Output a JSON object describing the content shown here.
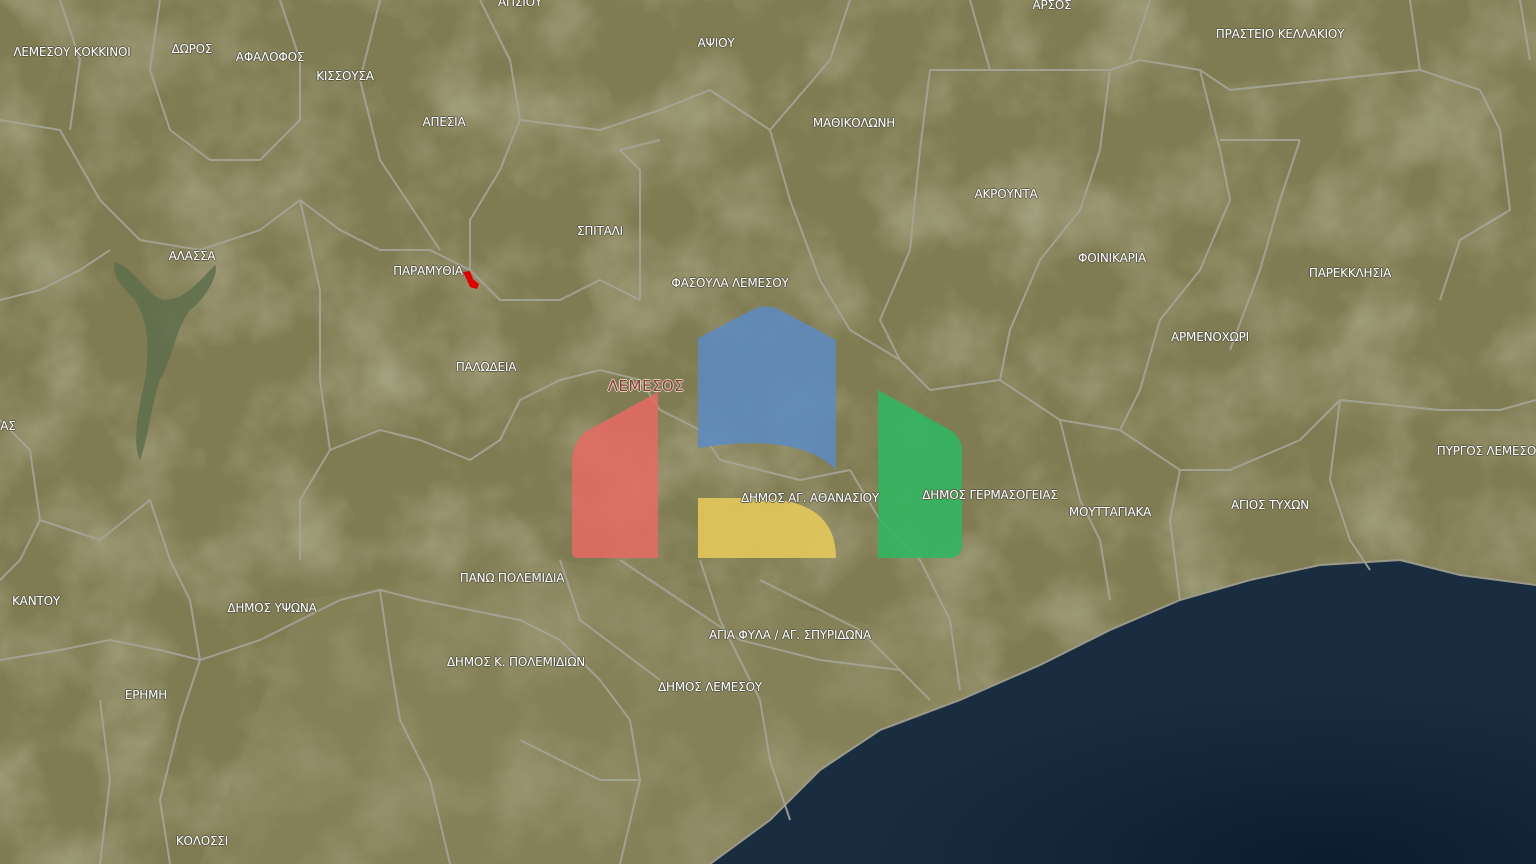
{
  "map": {
    "colors": {
      "land": "#7f7b52",
      "sea": "#0e2236",
      "boundary": "#a5a596",
      "marker": "#e00000"
    },
    "labels": [
      {
        "id": "lemesou-kokkinoi",
        "text": "ΛΕΜΕΣΟΥ ΚΟΚΚΙΝΟΙ"
      },
      {
        "id": "doros",
        "text": "ΔΩΡΟΣ"
      },
      {
        "id": "lofos",
        "text": "ΑΦΑΛΟΦΟΣ"
      },
      {
        "id": "ypsonas-top",
        "text": "ΑΠΣΙΟΥ"
      },
      {
        "id": "kissousa",
        "text": "ΚΙΣΣΟΥΣΑ"
      },
      {
        "id": "laneia",
        "text": "ΑΠΕΣΙΑ"
      },
      {
        "id": "apsiou",
        "text": "ΑΨΙΟΥ"
      },
      {
        "id": "arsos",
        "text": "ΑΡΣΟΣ"
      },
      {
        "id": "praistio",
        "text": "ΠΡΑΣΤΕΙΟ ΚΕΛΛΑΚΙΟΥ"
      },
      {
        "id": "mathikoloni",
        "text": "ΜΑΘΙΚΟΛΩΝΗ"
      },
      {
        "id": "akrounta",
        "text": "ΑΚΡΟΥΝΤΑ"
      },
      {
        "id": "alassa",
        "text": "ΑΛΑΣΣΑ"
      },
      {
        "id": "spitali",
        "text": "ΣΠΙΤΑΛΙ"
      },
      {
        "id": "palodeia-n",
        "text": "ΠΑΡΑΜΥΘΙΑ"
      },
      {
        "id": "fasoula",
        "text": "ΦΑΣΟΥΛΑ ΛΕΜΕΣΟΥ"
      },
      {
        "id": "foinikaria",
        "text": "ΦΟΙΝΙΚΑΡΙΑ"
      },
      {
        "id": "parekklisia",
        "text": "ΠΑΡΕΚΚΛΗΣΙΑ"
      },
      {
        "id": "armenochori",
        "text": "ΑΡΜΕΝΟΧΩΡΙ"
      },
      {
        "id": "palodeia",
        "text": "ΠΑΛΩΔΕΙΑ"
      },
      {
        "id": "lemesos",
        "text": "ΛΕΜΕΣΟΣ",
        "major": true
      },
      {
        "id": "left-edge",
        "text": "ΑΣ"
      },
      {
        "id": "pyrgos",
        "text": "ΠΥΡΓΟΣ ΛΕΜΕΣΟΥ"
      },
      {
        "id": "ag-athanasios",
        "text": "ΔΗΜΟΣ ΑΓ. ΑΘΑΝΑΣΙΟΥ"
      },
      {
        "id": "germasogeia",
        "text": "ΔΗΜΟΣ ΓΕΡΜΑΣΟΓΕΙΑΣ"
      },
      {
        "id": "mouttagiaka",
        "text": "ΜΟΥΤΤΑΓΙΑΚΑ"
      },
      {
        "id": "agios-tychon",
        "text": "ΑΓΙΟΣ ΤΥΧΩΝ"
      },
      {
        "id": "ano-polemidia",
        "text": "ΠΑΝΩ ΠΟΛΕΜΙΔΙΑ"
      },
      {
        "id": "kantou",
        "text": "ΚΑΝΤΟΥ"
      },
      {
        "id": "ypsonas",
        "text": "ΔΗΜΟΣ ΥΨΩΝΑ"
      },
      {
        "id": "agia-fylaxi",
        "text": "ΑΓΙΑ ΦΥΛΑ / ΑΓ. ΣΠΥΡΙΔΩΝΑ"
      },
      {
        "id": "kato-polemidia",
        "text": "ΔΗΜΟΣ Κ. ΠΟΛΕΜΙΔΙΩΝ"
      },
      {
        "id": "erimi",
        "text": "ΕΡΗΜΗ"
      },
      {
        "id": "lemesos-dimos",
        "text": "ΔΗΜΟΣ ΛΕΜΕΣΟΥ"
      },
      {
        "id": "kolossi",
        "text": "ΚΟΛΟΣΣΙ"
      }
    ]
  }
}
